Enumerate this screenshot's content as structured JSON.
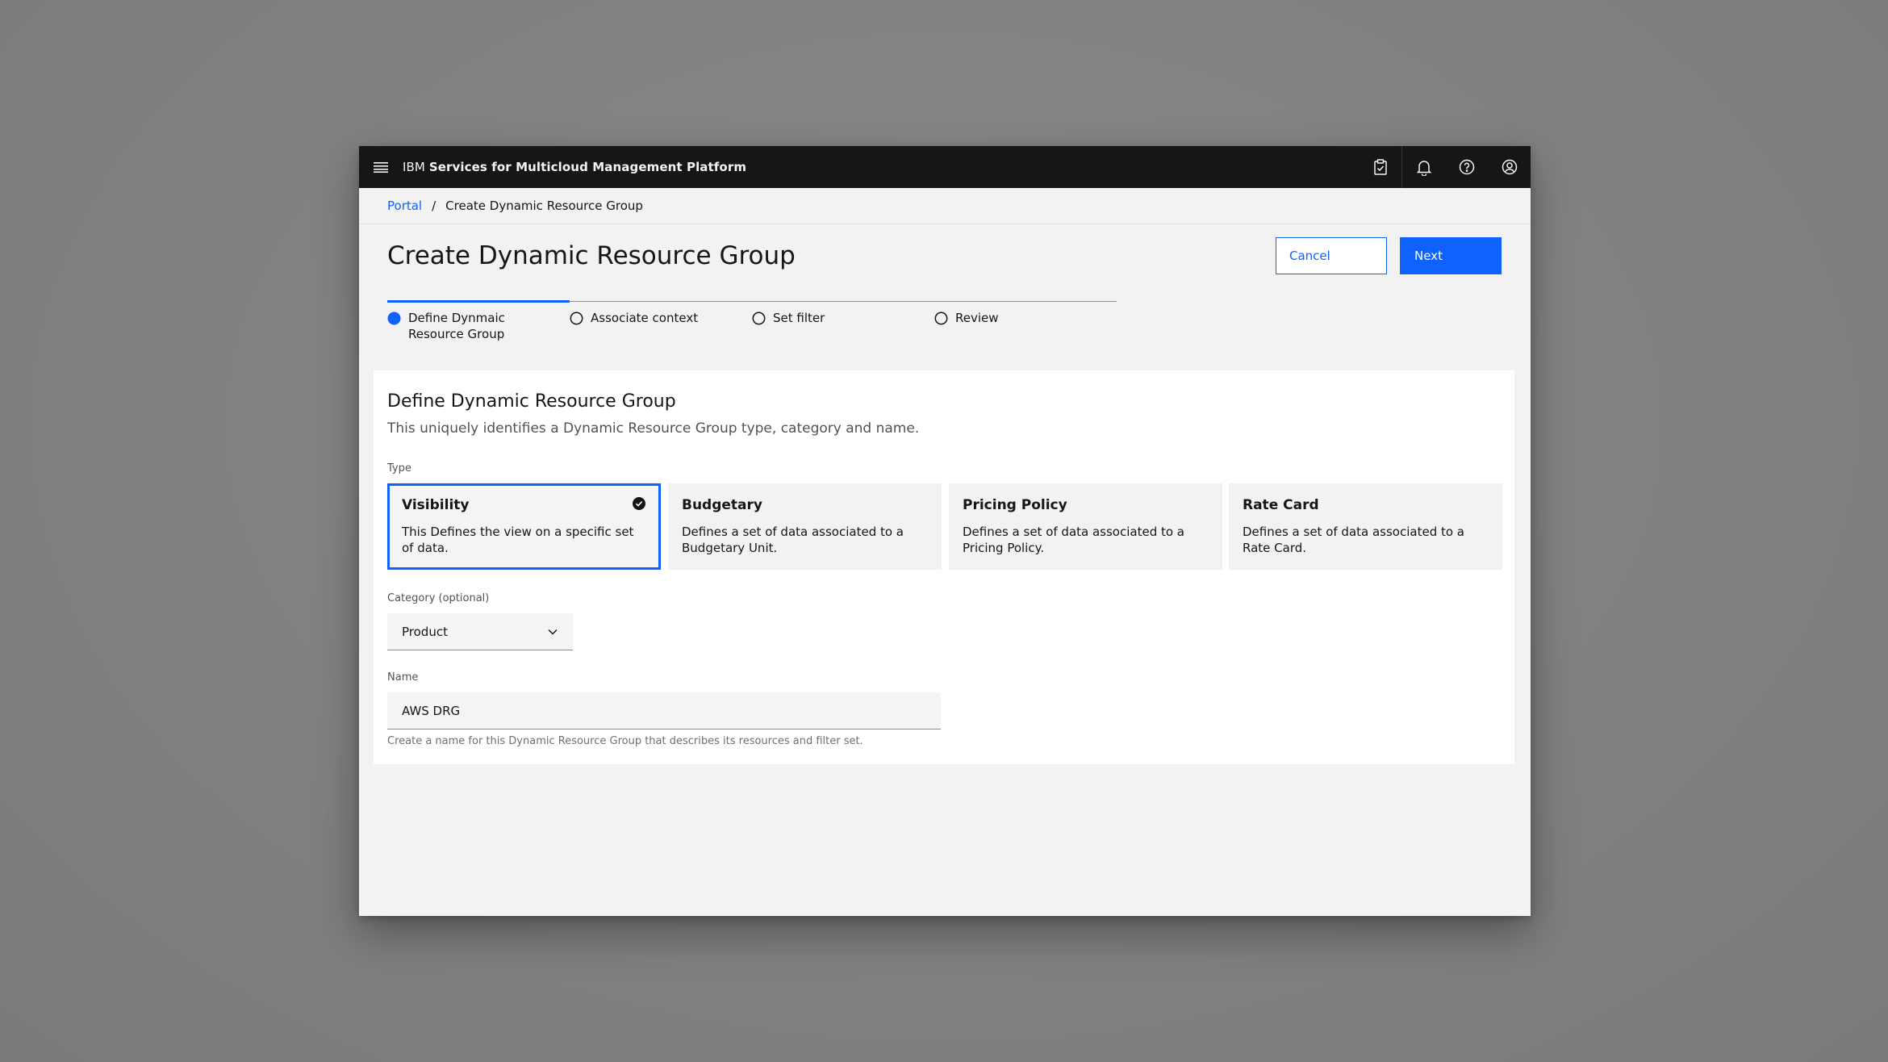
{
  "topbar": {
    "brand_ibm": "IBM",
    "brand_product": "Services for Multicloud Management Platform",
    "icons": [
      "menu-icon",
      "clipboard-check-icon",
      "notification-icon",
      "help-icon",
      "user-avatar-icon"
    ]
  },
  "breadcrumb": {
    "root": "Portal",
    "separator": "/",
    "current": "Create Dynamic Resource Group"
  },
  "page": {
    "title": "Create Dynamic Resource Group",
    "cancel_label": "Cancel",
    "next_label": "Next"
  },
  "progress": {
    "steps": [
      {
        "label": "Define Dynmaic Resource Group",
        "state": "current"
      },
      {
        "label": "Associate context",
        "state": "incomplete"
      },
      {
        "label": "Set filter",
        "state": "incomplete"
      },
      {
        "label": "Review",
        "state": "incomplete"
      }
    ]
  },
  "form": {
    "title": "Define Dynamic Resource Group",
    "description": "This uniquely identifies a Dynamic Resource Group type, category and name.",
    "type_label": "Type",
    "tiles": [
      {
        "title": "Visibility",
        "description": "This Defines the view on a specific set of data.",
        "selected": true
      },
      {
        "title": "Budgetary",
        "description": "Defines a set of data associated to a Budgetary Unit.",
        "selected": false
      },
      {
        "title": "Pricing Policy",
        "description": "Defines a set of data associated to a Pricing Policy.",
        "selected": false
      },
      {
        "title": "Rate Card",
        "description": "Defines a set of data associated to a Rate Card.",
        "selected": false
      }
    ],
    "category_label": "Category (optional)",
    "category_value": "Product",
    "name_label": "Name",
    "name_value": "AWS DRG",
    "name_helper": "Create a name for this Dynamic Resource Group that describes its resources and filter set."
  },
  "colors": {
    "accent": "#0f62fe",
    "topbar": "#161616",
    "page_bg": "#f2f2f2"
  }
}
